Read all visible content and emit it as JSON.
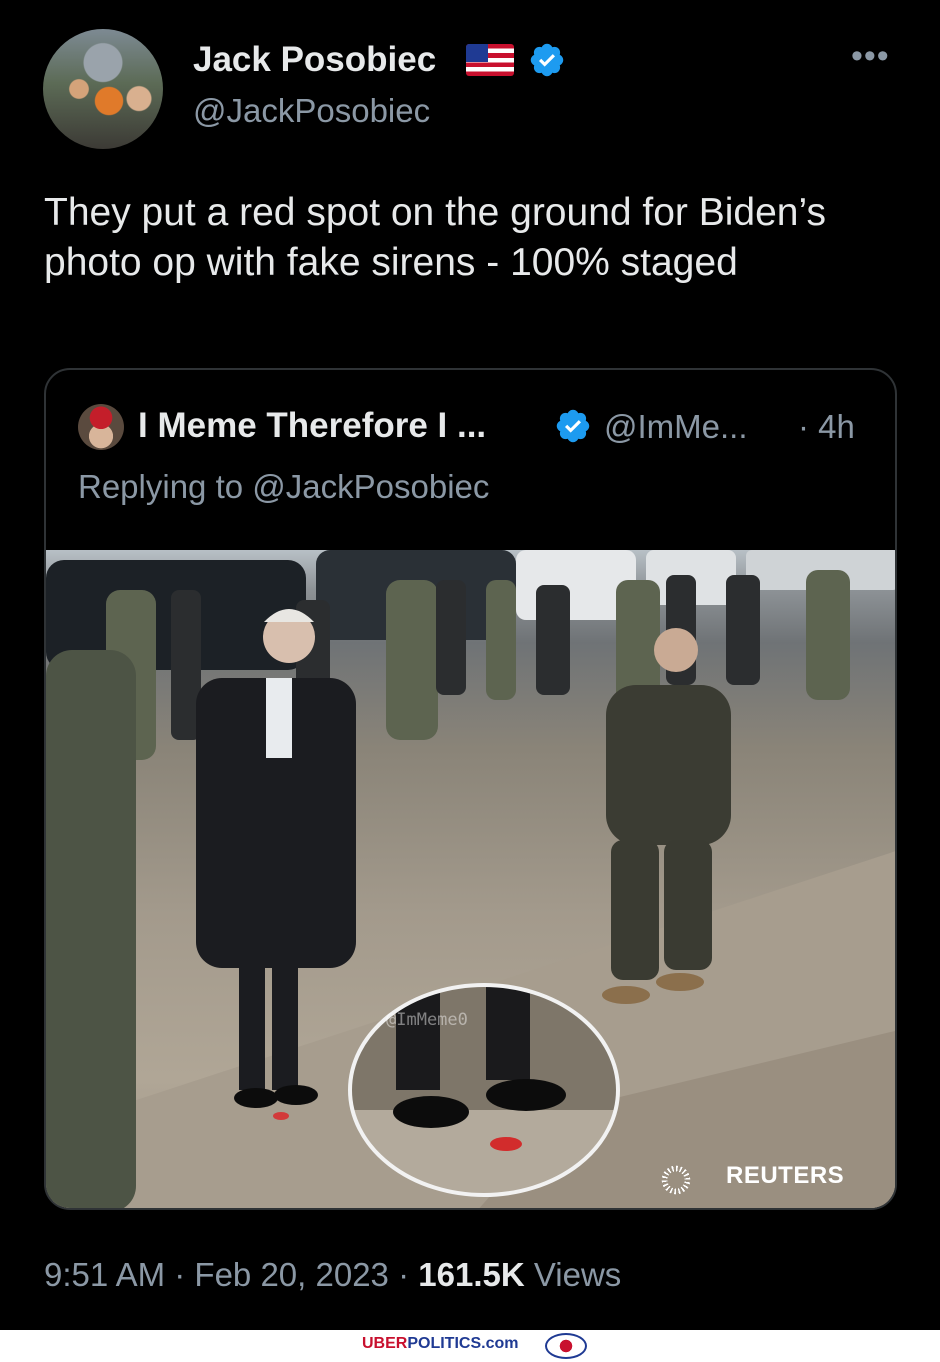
{
  "tweet": {
    "author_name": "Jack Posobiec",
    "author_handle": "@JackPosobiec",
    "text": "They put a red spot on the ground for Biden’s photo op with fake sirens - 100% staged",
    "time": "9:51 AM",
    "separator1": "·",
    "date": "Feb 20, 2023",
    "separator2": "·",
    "views_count": "161.5K",
    "views_label": "Views"
  },
  "quote": {
    "author_name": "I Meme Therefore I ...",
    "author_handle": "@ImMe...",
    "time": "· 4h",
    "replying_to": "Replying to @JackPosobiec",
    "image_watermark": "@ImMeme0",
    "image_credit": "REUTERS"
  },
  "footer": {
    "brand_red": "UBER",
    "brand_blue": "POLITICS.com"
  },
  "colors": {
    "background": "#000000",
    "text_primary": "#e7e9ea",
    "text_secondary": "#8b98a5",
    "verified_blue": "#1d9bf0",
    "card_border": "#2f3336"
  },
  "icons": [
    "flag-us-icon",
    "verified-icon",
    "more-icon",
    "reuters-logo-icon"
  ]
}
